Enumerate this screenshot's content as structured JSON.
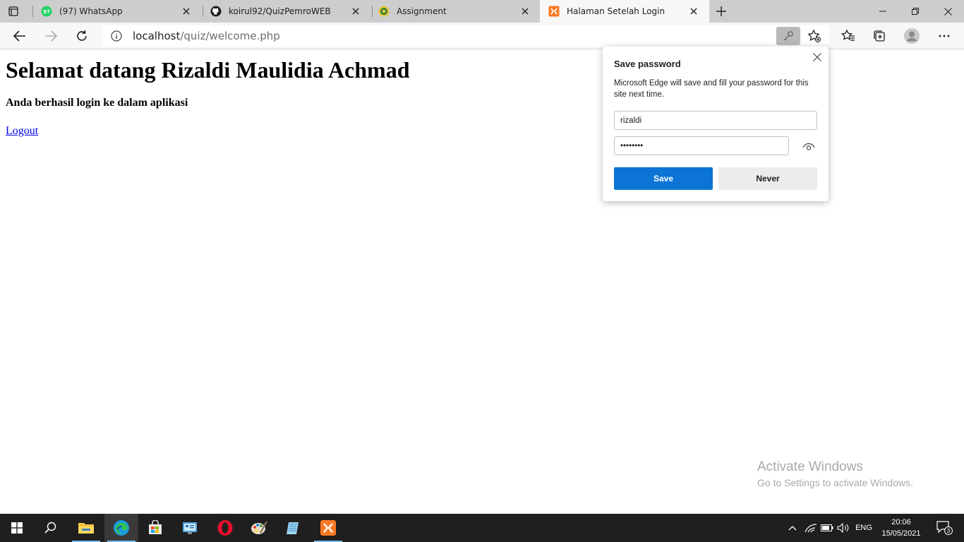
{
  "tabs": [
    {
      "label": "(97) WhatsApp",
      "icon": "whatsapp-icon",
      "badge": "97"
    },
    {
      "label": "koirul92/QuizPemroWEB",
      "icon": "github-icon"
    },
    {
      "label": "Assignment",
      "icon": "university-logo-icon"
    },
    {
      "label": "Halaman Setelah Login",
      "icon": "xampp-icon",
      "active": true
    }
  ],
  "address_bar": {
    "host": "localhost",
    "path": "/quiz/welcome.php"
  },
  "page": {
    "heading": "Selamat datang Rizaldi Maulidia Achmad",
    "subheading": "Anda berhasil login ke dalam aplikasi",
    "logout_link": "Logout"
  },
  "save_password_popup": {
    "title": "Save password",
    "description": "Microsoft Edge will save and fill your password for this site next time.",
    "username": "rizaldi",
    "password_mask": "••••••••",
    "save_label": "Save",
    "never_label": "Never"
  },
  "watermark": {
    "line1": "Activate Windows",
    "line2": "Go to Settings to activate Windows."
  },
  "taskbar": {
    "apps": [
      "start-icon",
      "search-icon",
      "file-explorer-icon",
      "edge-icon",
      "store-icon",
      "control-panel-icon",
      "opera-icon",
      "paint-icon",
      "notepad-icon",
      "xampp-icon"
    ],
    "language": "ENG",
    "time": "20:06",
    "date": "15/05/2021",
    "notification_count": "3"
  },
  "colors": {
    "accent": "#0b74d4",
    "link": "#0000ee",
    "tabstrip": "#cdcdcd",
    "taskbar": "#1f1f1f"
  }
}
